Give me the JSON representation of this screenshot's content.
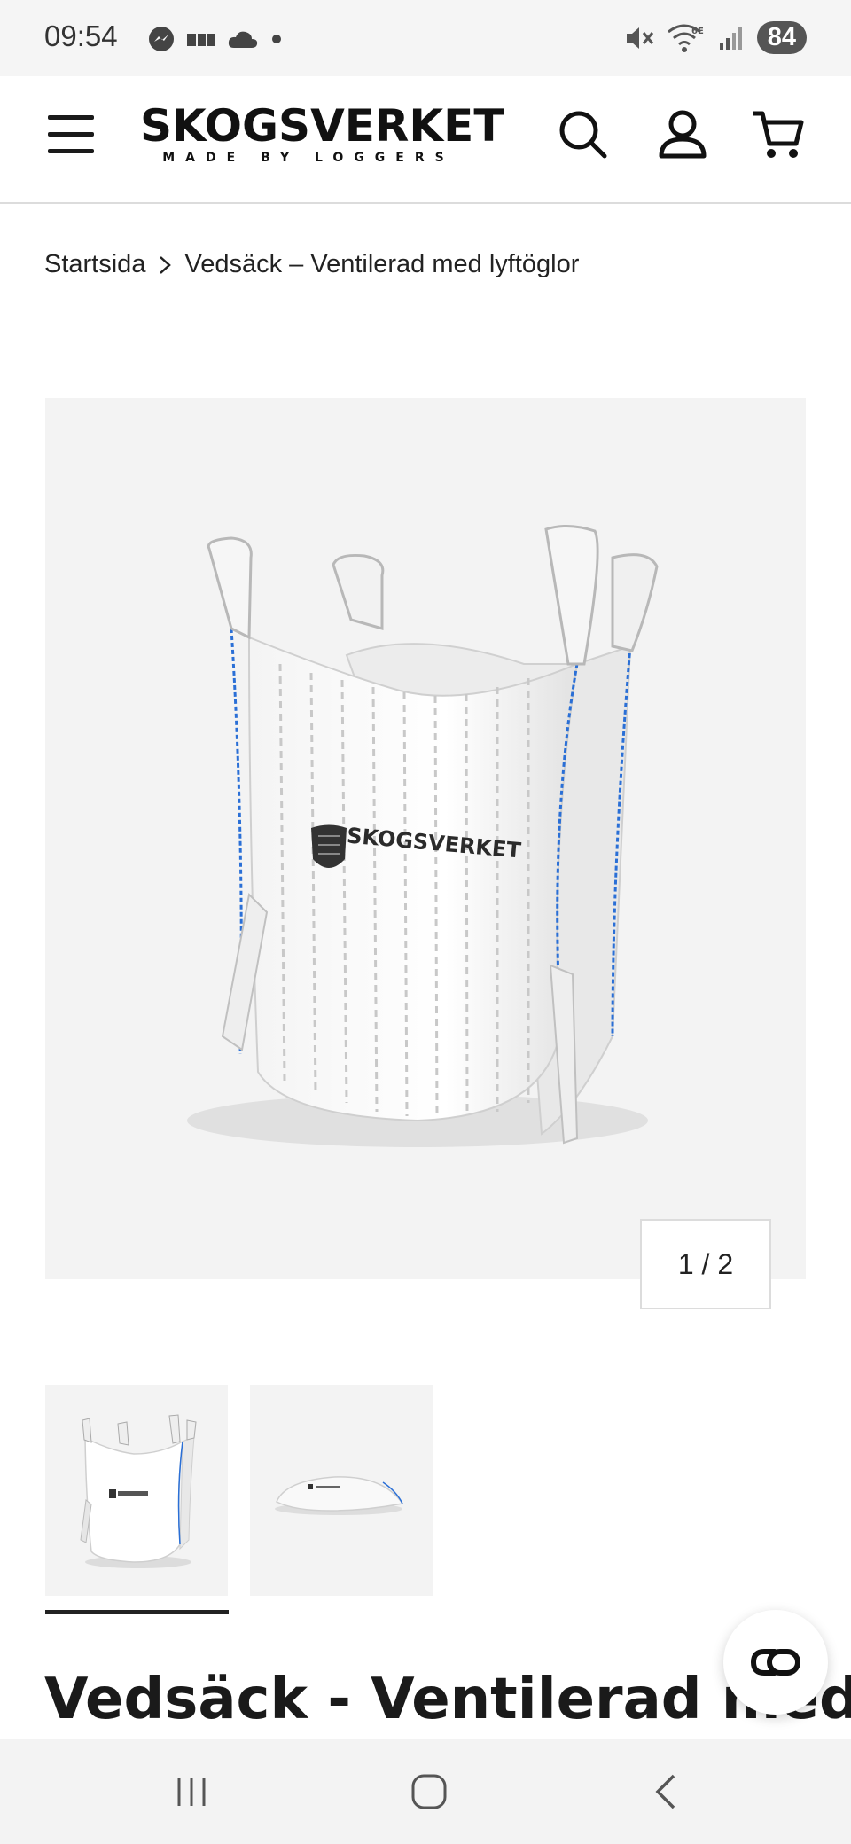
{
  "status_bar": {
    "time": "09:54",
    "battery": "84",
    "left_icons": [
      "messenger-icon",
      "notification-icon",
      "cloud-icon",
      "dot-icon"
    ],
    "right_icons": [
      "mute-icon",
      "wifi-6e-icon",
      "signal-icon"
    ]
  },
  "header": {
    "logo_main": "SKOGSVERKET",
    "logo_sub": "MADE BY LOGGERS",
    "icons": [
      "menu-icon",
      "search-icon",
      "account-icon",
      "cart-icon"
    ]
  },
  "breadcrumb": {
    "home": "Startsida",
    "current": "Vedsäck – Ventilerad med lyftöglor"
  },
  "gallery": {
    "counter": "1 / 2",
    "current_index": 1,
    "total": 2,
    "bag_print": "SKOGSVERKET"
  },
  "product": {
    "title": "Vedsäck - Ventilerad med"
  },
  "colors": {
    "accent_blue": "#2a6fd6",
    "text": "#1a1a1a",
    "image_bg": "#f3f3f3"
  }
}
